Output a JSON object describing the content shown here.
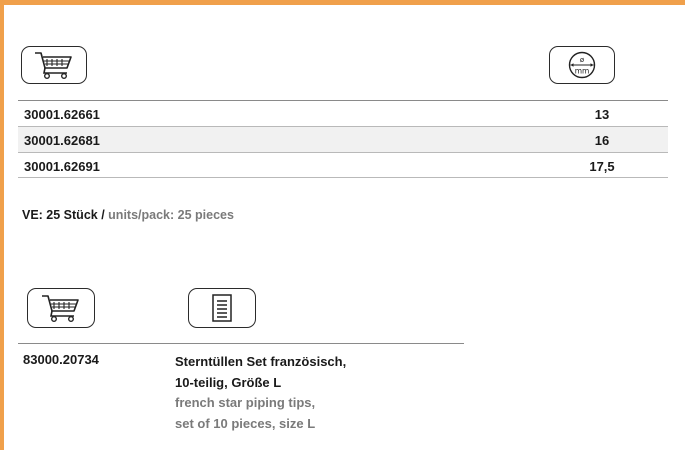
{
  "icons": {
    "cart": "shopping-cart-icon",
    "diameter": "diameter-mm-icon",
    "document": "document-icon",
    "diameter_symbol": "ø",
    "diameter_unit": "mm"
  },
  "table1": {
    "rows": [
      {
        "article": "30001.62661",
        "diameter": "13"
      },
      {
        "article": "30001.62681",
        "diameter": "16"
      },
      {
        "article": "30001.62691",
        "diameter": "17,5"
      }
    ]
  },
  "ve": {
    "de": "VE: 25 Stück /",
    "en": "units/pack: 25 pieces"
  },
  "table2": {
    "article": "83000.20734",
    "desc_de_1": "Sterntüllen Set französisch,",
    "desc_de_2": "10-teilig, Größe L",
    "desc_en_1": "french star piping tips,",
    "desc_en_2": "set of 10 pieces, size L"
  },
  "colors": {
    "accent": "#f0a04b",
    "row_shade": "#f1f1f1",
    "english_text": "#7a7a7a"
  }
}
